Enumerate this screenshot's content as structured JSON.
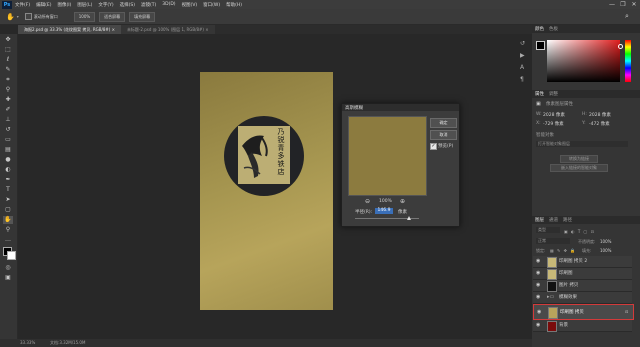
{
  "app": {
    "logo": "Ps"
  },
  "menu": [
    "文件(F)",
    "编辑(E)",
    "图像(I)",
    "图层(L)",
    "文字(Y)",
    "选择(S)",
    "滤镜(T)",
    "3D(D)",
    "视图(V)",
    "窗口(W)",
    "帮助(H)"
  ],
  "window_controls": {
    "minimize": "—",
    "restore": "❐",
    "close": "✕"
  },
  "options_bar": {
    "scroll_all_label": "滚动所有窗口",
    "zoom_100": "100%",
    "fit_screen": "适合屏幕",
    "fill_screen": "填充屏幕"
  },
  "tabs": [
    {
      "label": "海报2.psd @ 33.3% (花纹图案 拷贝, RGB/8#) ×",
      "active": true
    },
    {
      "label": "未标题-2.psd @ 100% (图层 1, RGB/8#) ×",
      "active": false
    }
  ],
  "status": {
    "zoom": "33.33%",
    "doc": "文档:3.32M/15.0M"
  },
  "color_panel": {
    "tab_color": "颜色",
    "tab_swatch": "色板"
  },
  "properties_panel": {
    "tab": "属性",
    "tab2": "调整",
    "title": "像素图层属性",
    "w_label": "W:",
    "w_value": "2028 像素",
    "h_label": "H:",
    "h_value": "2028 像素",
    "x_label": "X:",
    "x_value": "-729 像素",
    "y_label": "Y:",
    "y_value": "-472 像素",
    "smart_label": "智能对象",
    "smart_source": "打开智能对象图层",
    "btn_convert": "转换为链接",
    "btn_embed": "嵌入链接的智能对象"
  },
  "layers_panel": {
    "tab_layers": "图层",
    "tab_channels": "通道",
    "tab_paths": "路径",
    "kind": "类型",
    "mode": "正常",
    "opacity_label": "不透明度:",
    "opacity": "100%",
    "lock_label": "锁定:",
    "fill_label": "填充:",
    "fill": "100%",
    "layers": [
      {
        "name": "印刷图 拷贝 2",
        "visible": true,
        "selected": false
      },
      {
        "name": "印刷图",
        "visible": true,
        "selected": false
      },
      {
        "name": "图片 拷贝",
        "visible": true,
        "selected": false
      },
      {
        "name": "模糊效果",
        "visible": true,
        "selected": false
      },
      {
        "name": "印刷图 拷贝",
        "visible": true,
        "selected": true
      },
      {
        "name": "背景",
        "visible": true,
        "selected": false
      }
    ]
  },
  "dialog": {
    "title": "高斯模糊",
    "ok": "确定",
    "cancel": "取消",
    "preview_label": "预览(P)",
    "preview_checked": true,
    "zoom": "100%",
    "radius_label": "半径(R):",
    "radius_value": "146.9",
    "unit": "像素",
    "radius_fraction": 0.85
  },
  "artwork": {
    "calligraphy": [
      "乃",
      "锐",
      "青",
      "多",
      "铁",
      "店"
    ]
  },
  "colors": {
    "accent_red": "#d33a3a",
    "doc_gold": "#a69650",
    "hue_red": "#e01e1e"
  }
}
